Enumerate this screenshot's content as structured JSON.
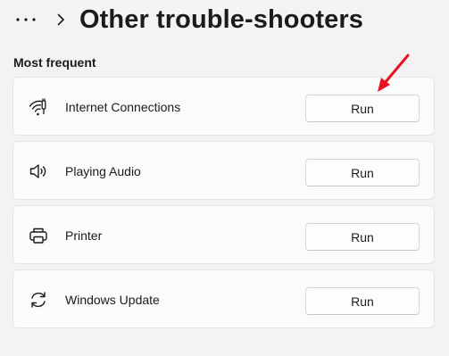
{
  "header": {
    "more_icon": "more-horizontal-icon",
    "chevron_icon": "chevron-right-icon",
    "title": "Other trouble-shooters"
  },
  "section": {
    "title": "Most frequent"
  },
  "troubleshooters": [
    {
      "label": "Internet Connections",
      "icon": "wifi-icon",
      "button_label": "Run"
    },
    {
      "label": "Playing Audio",
      "icon": "speaker-icon",
      "button_label": "Run"
    },
    {
      "label": "Printer",
      "icon": "printer-icon",
      "button_label": "Run"
    },
    {
      "label": "Windows Update",
      "icon": "sync-icon",
      "button_label": "Run"
    }
  ],
  "annotation": {
    "arrow_color": "#e81123"
  }
}
